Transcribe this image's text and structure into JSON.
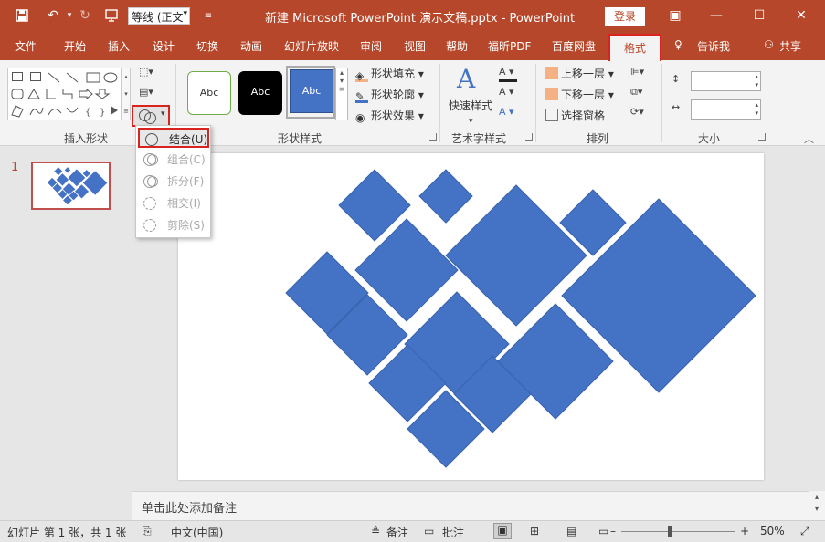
{
  "titlebar": {
    "font_name": "等线 (正文",
    "doc_title": "新建 Microsoft PowerPoint 演示文稿.pptx  -  PowerPoint",
    "login_label": "登录",
    "save_icon": "save-icon",
    "undo_icon": "undo-icon",
    "redo_icon": "redo-icon"
  },
  "tabs": [
    "文件",
    "开始",
    "插入",
    "设计",
    "切换",
    "动画",
    "幻灯片放映",
    "审阅",
    "视图",
    "帮助",
    "福昕PDF",
    "百度网盘"
  ],
  "active_tab": "格式",
  "tell_me": "告诉我",
  "share": "共享",
  "ribbon": {
    "group_insert_shapes": "插入形状",
    "group_shape_styles": "形状样式",
    "group_wordart": "艺术字样式",
    "group_arrange": "排列",
    "group_size": "大小",
    "style_samples": [
      "Abc",
      "Abc",
      "Abc"
    ],
    "shape_fill": "形状填充",
    "shape_outline": "形状轮廓",
    "shape_effects": "形状效果",
    "quick_styles": "快速样式",
    "bring_forward": "上移一层",
    "send_backward": "下移一层",
    "selection_pane": "选择窗格"
  },
  "merge_menu": {
    "items": [
      "结合(U)",
      "组合(C)",
      "拆分(F)",
      "相交(I)",
      "剪除(S)"
    ]
  },
  "thumbs": {
    "slide_number": "1"
  },
  "notes": {
    "placeholder": "单击此处添加备注"
  },
  "status": {
    "slide_info": "幻灯片 第 1 张，共 1 张",
    "language": "中文(中国)",
    "notes_btn": "备注",
    "comments_btn": "批注",
    "zoom": "50%"
  },
  "colors": {
    "accent": "#b7472a",
    "shape_fill": "#4472c4",
    "highlight": "#d9231e"
  }
}
